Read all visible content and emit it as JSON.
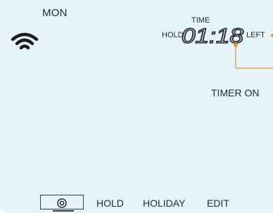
{
  "display": {
    "day": "MON",
    "hold_label": "HOLD",
    "time_label": "TIME",
    "time_value": "01:18",
    "left_label": "LEFT",
    "timer_status": "TIMER ON",
    "wifi_icon": "wifi-icon",
    "colors": {
      "screen_bg": "#e4f4fa",
      "text": "#2a2a2a",
      "callout": "#e39a2b"
    }
  },
  "menu": {
    "power_icon": "power-icon",
    "items": [
      {
        "label": "HOLD"
      },
      {
        "label": "HOLIDAY"
      },
      {
        "label": "EDIT"
      }
    ]
  }
}
